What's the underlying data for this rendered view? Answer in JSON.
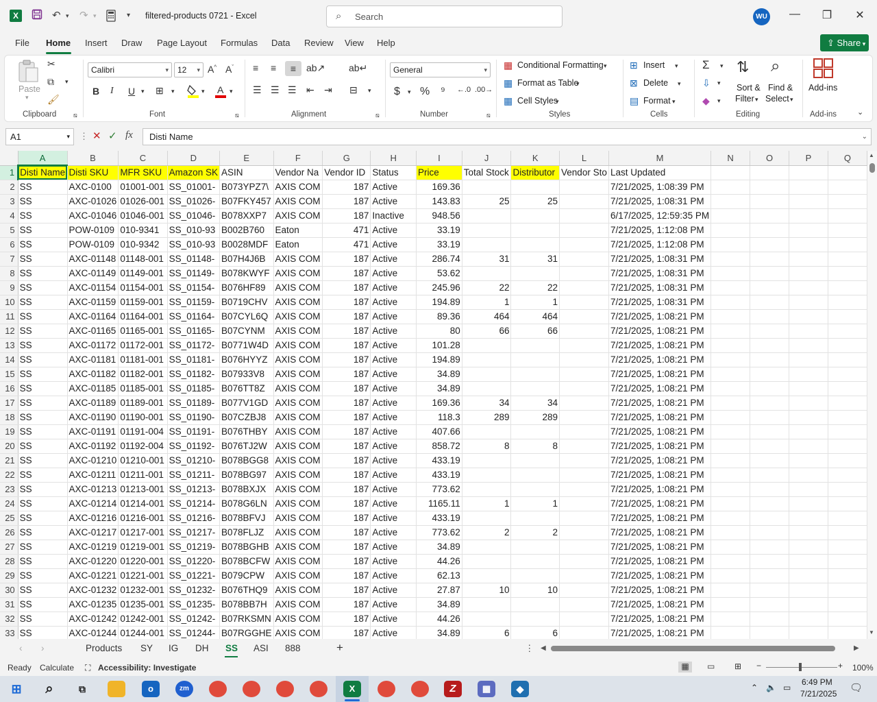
{
  "titlebar": {
    "app_logo": "X",
    "doc_title": "filtered-products 0721  -  Excel",
    "search_placeholder": "Search",
    "user_initials": "WU",
    "qat_icons": [
      "save-icon",
      "undo-icon",
      "redo-icon",
      "calculator-icon"
    ]
  },
  "menu": {
    "items": [
      "File",
      "Home",
      "Insert",
      "Draw",
      "Page Layout",
      "Formulas",
      "Data",
      "Review",
      "View",
      "Help"
    ],
    "active": "Home",
    "share_label": "Share"
  },
  "ribbon": {
    "clipboard": {
      "label": "Clipboard",
      "paste": "Paste"
    },
    "font": {
      "label": "Font",
      "font_name": "Calibri",
      "font_size": "12"
    },
    "alignment": {
      "label": "Alignment"
    },
    "number": {
      "label": "Number",
      "format": "General"
    },
    "styles": {
      "label": "Styles",
      "conditional": "Conditional Formatting",
      "format_table": "Format as Table",
      "cell_styles": "Cell Styles"
    },
    "cells": {
      "label": "Cells",
      "insert": "Insert",
      "delete": "Delete",
      "format": "Format"
    },
    "editing": {
      "label": "Editing",
      "sort_filter_1": "Sort &",
      "sort_filter_2": "Filter",
      "find_select_1": "Find &",
      "find_select_2": "Select"
    },
    "addins": {
      "label": "Add-ins",
      "button": "Add-ins"
    }
  },
  "formula_bar": {
    "name_box": "A1",
    "fx": "fx",
    "content": "Disti Name"
  },
  "sheet": {
    "columns": [
      "A",
      "B",
      "C",
      "D",
      "E",
      "F",
      "G",
      "H",
      "I",
      "J",
      "K",
      "L",
      "M",
      "N",
      "O",
      "P",
      "Q"
    ],
    "headers": [
      "Disti Name",
      "Disti SKU",
      "MFR SKU",
      "Amazon SK",
      "ASIN",
      "Vendor Na",
      "Vendor ID",
      "Status",
      "Price",
      "Total Stock",
      "Distributor",
      "Vendor Sto",
      "Last Updated",
      "",
      "",
      "",
      ""
    ],
    "highlight_color": "#ffff00",
    "rows": [
      [
        "SS",
        "AXC-0100",
        "01001-001",
        "SS_01001-",
        "B073YPZ7\\",
        "AXIS COM",
        "187",
        "Active",
        "169.36",
        "",
        "",
        "",
        "7/21/2025, 1:08:39 PM"
      ],
      [
        "SS",
        "AXC-01026",
        "01026-001",
        "SS_01026-",
        "B07FKY457",
        "AXIS COM",
        "187",
        "Active",
        "143.83",
        "25",
        "25",
        "",
        "7/21/2025, 1:08:31 PM"
      ],
      [
        "SS",
        "AXC-01046",
        "01046-001",
        "SS_01046-",
        "B078XXP7",
        "AXIS COM",
        "187",
        "Inactive",
        "948.56",
        "",
        "",
        "",
        "6/17/2025, 12:59:35 PM"
      ],
      [
        "SS",
        "POW-0109",
        "010-9341",
        "SS_010-93",
        "B002B760",
        "Eaton",
        "471",
        "Active",
        "33.19",
        "",
        "",
        "",
        "7/21/2025, 1:12:08 PM"
      ],
      [
        "SS",
        "POW-0109",
        "010-9342",
        "SS_010-93",
        "B0028MDF",
        "Eaton",
        "471",
        "Active",
        "33.19",
        "",
        "",
        "",
        "7/21/2025, 1:12:08 PM"
      ],
      [
        "SS",
        "AXC-01148",
        "01148-001",
        "SS_01148-",
        "B07H4J6B",
        "AXIS COM",
        "187",
        "Active",
        "286.74",
        "31",
        "31",
        "",
        "7/21/2025, 1:08:31 PM"
      ],
      [
        "SS",
        "AXC-01149",
        "01149-001",
        "SS_01149-",
        "B078KWYF",
        "AXIS COM",
        "187",
        "Active",
        "53.62",
        "",
        "",
        "",
        "7/21/2025, 1:08:31 PM"
      ],
      [
        "SS",
        "AXC-01154",
        "01154-001",
        "SS_01154-",
        "B076HF89",
        "AXIS COM",
        "187",
        "Active",
        "245.96",
        "22",
        "22",
        "",
        "7/21/2025, 1:08:31 PM"
      ],
      [
        "SS",
        "AXC-01159",
        "01159-001",
        "SS_01159-",
        "B0719CHV",
        "AXIS COM",
        "187",
        "Active",
        "194.89",
        "1",
        "1",
        "",
        "7/21/2025, 1:08:31 PM"
      ],
      [
        "SS",
        "AXC-01164",
        "01164-001",
        "SS_01164-",
        "B07CYL6Q",
        "AXIS COM",
        "187",
        "Active",
        "89.36",
        "464",
        "464",
        "",
        "7/21/2025, 1:08:21 PM"
      ],
      [
        "SS",
        "AXC-01165",
        "01165-001",
        "SS_01165-",
        "B07CYNM",
        "AXIS COM",
        "187",
        "Active",
        "80",
        "66",
        "66",
        "",
        "7/21/2025, 1:08:21 PM"
      ],
      [
        "SS",
        "AXC-01172",
        "01172-001",
        "SS_01172-",
        "B0771W4D",
        "AXIS COM",
        "187",
        "Active",
        "101.28",
        "",
        "",
        "",
        "7/21/2025, 1:08:21 PM"
      ],
      [
        "SS",
        "AXC-01181",
        "01181-001",
        "SS_01181-",
        "B076HYYZ",
        "AXIS COM",
        "187",
        "Active",
        "194.89",
        "",
        "",
        "",
        "7/21/2025, 1:08:21 PM"
      ],
      [
        "SS",
        "AXC-01182",
        "01182-001",
        "SS_01182-",
        "B07933V8",
        "AXIS COM",
        "187",
        "Active",
        "34.89",
        "",
        "",
        "",
        "7/21/2025, 1:08:21 PM"
      ],
      [
        "SS",
        "AXC-01185",
        "01185-001",
        "SS_01185-",
        "B076TT8Z",
        "AXIS COM",
        "187",
        "Active",
        "34.89",
        "",
        "",
        "",
        "7/21/2025, 1:08:21 PM"
      ],
      [
        "SS",
        "AXC-01189",
        "01189-001",
        "SS_01189-",
        "B077V1GD",
        "AXIS COM",
        "187",
        "Active",
        "169.36",
        "34",
        "34",
        "",
        "7/21/2025, 1:08:21 PM"
      ],
      [
        "SS",
        "AXC-01190",
        "01190-001",
        "SS_01190-",
        "B07CZBJ8",
        "AXIS COM",
        "187",
        "Active",
        "118.3",
        "289",
        "289",
        "",
        "7/21/2025, 1:08:21 PM"
      ],
      [
        "SS",
        "AXC-01191",
        "01191-004",
        "SS_01191-",
        "B076THBY",
        "AXIS COM",
        "187",
        "Active",
        "407.66",
        "",
        "",
        "",
        "7/21/2025, 1:08:21 PM"
      ],
      [
        "SS",
        "AXC-01192",
        "01192-004",
        "SS_01192-",
        "B076TJ2W",
        "AXIS COM",
        "187",
        "Active",
        "858.72",
        "8",
        "8",
        "",
        "7/21/2025, 1:08:21 PM"
      ],
      [
        "SS",
        "AXC-01210",
        "01210-001",
        "SS_01210-",
        "B078BGG8",
        "AXIS COM",
        "187",
        "Active",
        "433.19",
        "",
        "",
        "",
        "7/21/2025, 1:08:21 PM"
      ],
      [
        "SS",
        "AXC-01211",
        "01211-001",
        "SS_01211-",
        "B078BG97",
        "AXIS COM",
        "187",
        "Active",
        "433.19",
        "",
        "",
        "",
        "7/21/2025, 1:08:21 PM"
      ],
      [
        "SS",
        "AXC-01213",
        "01213-001",
        "SS_01213-",
        "B078BXJX",
        "AXIS COM",
        "187",
        "Active",
        "773.62",
        "",
        "",
        "",
        "7/21/2025, 1:08:21 PM"
      ],
      [
        "SS",
        "AXC-01214",
        "01214-001",
        "SS_01214-",
        "B078G6LN",
        "AXIS COM",
        "187",
        "Active",
        "1165.11",
        "1",
        "1",
        "",
        "7/21/2025, 1:08:21 PM"
      ],
      [
        "SS",
        "AXC-01216",
        "01216-001",
        "SS_01216-",
        "B078BFVJ",
        "AXIS COM",
        "187",
        "Active",
        "433.19",
        "",
        "",
        "",
        "7/21/2025, 1:08:21 PM"
      ],
      [
        "SS",
        "AXC-01217",
        "01217-001",
        "SS_01217-",
        "B078FLJZ",
        "AXIS COM",
        "187",
        "Active",
        "773.62",
        "2",
        "2",
        "",
        "7/21/2025, 1:08:21 PM"
      ],
      [
        "SS",
        "AXC-01219",
        "01219-001",
        "SS_01219-",
        "B078BGHB",
        "AXIS COM",
        "187",
        "Active",
        "34.89",
        "",
        "",
        "",
        "7/21/2025, 1:08:21 PM"
      ],
      [
        "SS",
        "AXC-01220",
        "01220-001",
        "SS_01220-",
        "B078BCFW",
        "AXIS COM",
        "187",
        "Active",
        "44.26",
        "",
        "",
        "",
        "7/21/2025, 1:08:21 PM"
      ],
      [
        "SS",
        "AXC-01221",
        "01221-001",
        "SS_01221-",
        "B079CPW",
        "AXIS COM",
        "187",
        "Active",
        "62.13",
        "",
        "",
        "",
        "7/21/2025, 1:08:21 PM"
      ],
      [
        "SS",
        "AXC-01232",
        "01232-001",
        "SS_01232-",
        "B076THQ9",
        "AXIS COM",
        "187",
        "Active",
        "27.87",
        "10",
        "10",
        "",
        "7/21/2025, 1:08:21 PM"
      ],
      [
        "SS",
        "AXC-01235",
        "01235-001",
        "SS_01235-",
        "B078BB7H",
        "AXIS COM",
        "187",
        "Active",
        "34.89",
        "",
        "",
        "",
        "7/21/2025, 1:08:21 PM"
      ],
      [
        "SS",
        "AXC-01242",
        "01242-001",
        "SS_01242-",
        "B07RKSMN",
        "AXIS COM",
        "187",
        "Active",
        "44.26",
        "",
        "",
        "",
        "7/21/2025, 1:08:21 PM"
      ],
      [
        "SS",
        "AXC-01244",
        "01244-001",
        "SS_01244-",
        "B07RGGHE",
        "AXIS COM",
        "187",
        "Active",
        "34.89",
        "6",
        "6",
        "",
        "7/21/2025, 1:08:21 PM"
      ]
    ]
  },
  "sheet_tabs": {
    "tabs": [
      "Products",
      "SY",
      "IG",
      "DH",
      "SS",
      "ASI",
      "888"
    ],
    "active": "SS",
    "add": "+"
  },
  "statusbar": {
    "ready": "Ready",
    "calculate": "Calculate",
    "accessibility": "Accessibility: Investigate",
    "zoom": "100%"
  },
  "taskbar": {
    "time": "6:49 PM",
    "date": "7/21/2025"
  }
}
